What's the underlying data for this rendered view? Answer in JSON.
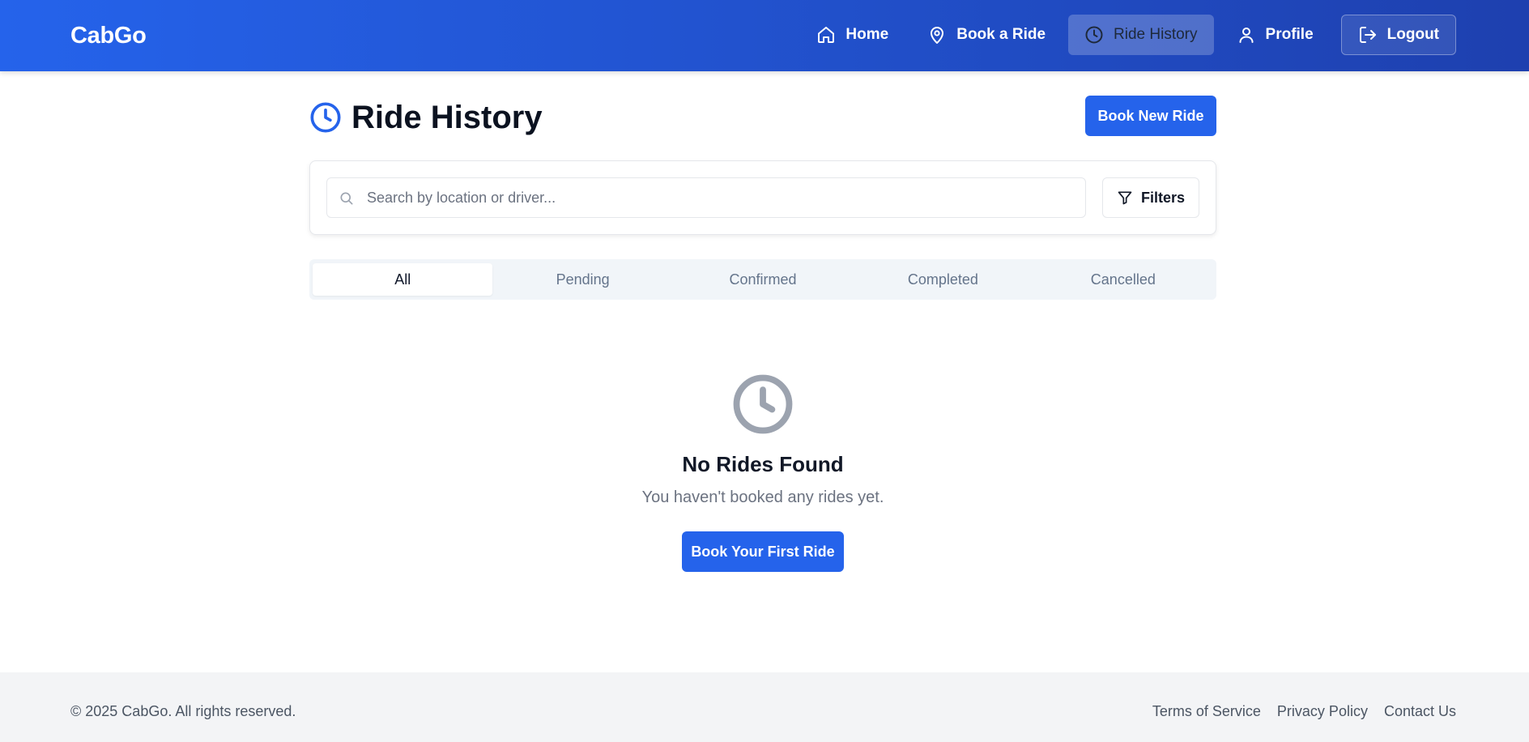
{
  "header": {
    "brand": "CabGo",
    "nav": [
      {
        "label": "Home",
        "icon": "home-icon"
      },
      {
        "label": "Book a Ride",
        "icon": "map-pin-icon"
      },
      {
        "label": "Ride History",
        "icon": "clock-icon",
        "active": true
      },
      {
        "label": "Profile",
        "icon": "user-icon"
      },
      {
        "label": "Logout",
        "icon": "logout-icon"
      }
    ]
  },
  "page": {
    "title": "Ride History",
    "title_icon": "clock-icon",
    "book_new_label": "Book New Ride"
  },
  "search": {
    "placeholder": "Search by location or driver...",
    "value": "",
    "filters_label": "Filters"
  },
  "tabs": [
    {
      "label": "All",
      "active": true
    },
    {
      "label": "Pending"
    },
    {
      "label": "Confirmed"
    },
    {
      "label": "Completed"
    },
    {
      "label": "Cancelled"
    }
  ],
  "empty_state": {
    "icon": "clock-icon",
    "title": "No Rides Found",
    "subtitle": "You haven't booked any rides yet.",
    "cta_label": "Book Your First Ride"
  },
  "footer": {
    "copyright": "© 2025 CabGo. All rights reserved.",
    "links": [
      "Terms of Service",
      "Privacy Policy",
      "Contact Us"
    ]
  },
  "colors": {
    "primary": "#2563eb",
    "header_gradient_end": "#1e40af",
    "muted_text": "#6b7280",
    "footer_bg": "#f3f4f6"
  }
}
